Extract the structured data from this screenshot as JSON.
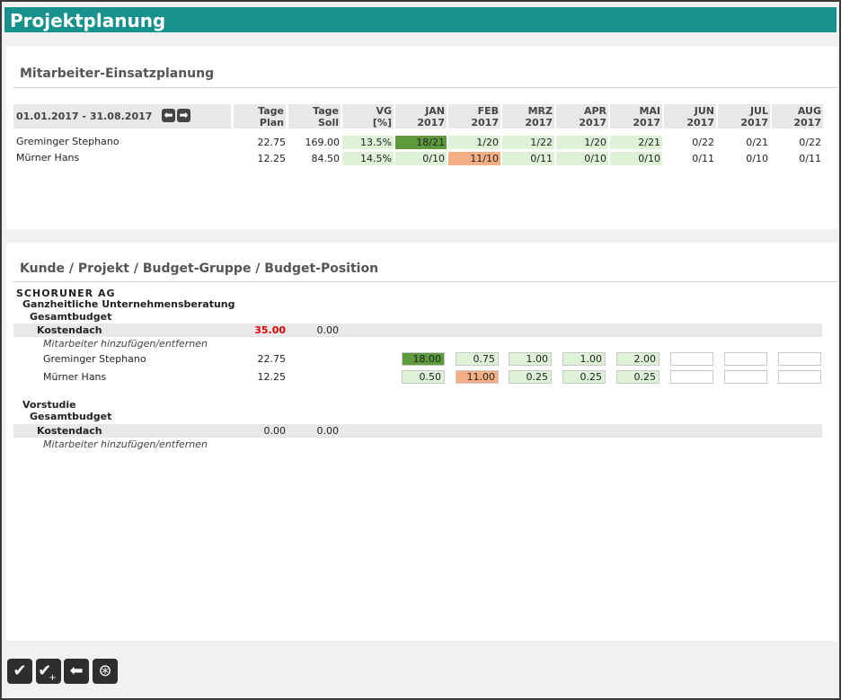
{
  "app": {
    "title": "Projektplanung"
  },
  "section1": {
    "title": "Mitarbeiter-Einsatzplanung",
    "date_range": "01.01.2017 - 31.08.2017",
    "headers": {
      "plan": [
        "Tage",
        "Plan"
      ],
      "soll": [
        "Tage",
        "Soll"
      ],
      "vg": [
        "VG",
        "[%]"
      ],
      "months": [
        [
          "JAN",
          "2017"
        ],
        [
          "FEB",
          "2017"
        ],
        [
          "MRZ",
          "2017"
        ],
        [
          "APR",
          "2017"
        ],
        [
          "MAI",
          "2017"
        ],
        [
          "JUN",
          "2017"
        ],
        [
          "JUL",
          "2017"
        ],
        [
          "AUG",
          "2017"
        ]
      ]
    },
    "rows": [
      {
        "name": "Greminger Stephano",
        "plan": "22.75",
        "soll": "169.00",
        "vg": "13.5%",
        "months": [
          "18/21",
          "1/20",
          "1/22",
          "1/20",
          "2/21",
          "0/22",
          "0/21",
          "0/22"
        ],
        "month_status": [
          "high",
          "light",
          "light",
          "light",
          "light",
          "none",
          "none",
          "none"
        ]
      },
      {
        "name": "Mürner Hans",
        "plan": "12.25",
        "soll": "84.50",
        "vg": "14.5%",
        "months": [
          "0/10",
          "11/10",
          "0/11",
          "0/10",
          "0/10",
          "0/11",
          "0/10",
          "0/11"
        ],
        "month_status": [
          "light",
          "over",
          "light",
          "light",
          "light",
          "none",
          "none",
          "none"
        ]
      }
    ]
  },
  "section2": {
    "title": "Kunde / Projekt / Budget-Gruppe / Budget-Position",
    "client": "SCHORUNER AG",
    "projects": [
      {
        "name": "Ganzheitliche Unternehmensberatung",
        "budget_group": "Gesamtbudget",
        "position": {
          "label": "Kostendach",
          "value1": "35.00",
          "value2": "0.00"
        },
        "add_remove_link": "Mitarbeiter hinzufügen/entfernen",
        "employees": [
          {
            "name": "Greminger Stephano",
            "plan": "22.75",
            "months": [
              "18.00",
              "0.75",
              "1.00",
              "1.00",
              "2.00",
              "",
              "",
              ""
            ]
          },
          {
            "name": "Mürner Hans",
            "plan": "12.25",
            "months": [
              "0.50",
              "11.00",
              "0.25",
              "0.25",
              "0.25",
              "",
              "",
              ""
            ]
          }
        ]
      },
      {
        "name": "Vorstudie",
        "budget_group": "Gesamtbudget",
        "position": {
          "label": "Kostendach",
          "value1": "0.00",
          "value2": "0.00"
        },
        "add_remove_link": "Mitarbeiter hinzufügen/entfernen",
        "employees": []
      }
    ]
  },
  "toolbar": {
    "buttons": [
      {
        "name": "save-button",
        "icon": "check-icon",
        "glyph": "✔"
      },
      {
        "name": "save-add-button",
        "icon": "check-plus-icon",
        "glyph": "✔"
      },
      {
        "name": "back-button",
        "icon": "arrow-left-icon",
        "glyph": "⬅"
      },
      {
        "name": "help-button",
        "icon": "lifebuoy-icon",
        "glyph": "⊛"
      }
    ]
  },
  "colors": {
    "header": "#17918b",
    "over": "#f3ae84",
    "high": "#5e9a3c",
    "light": "#def2d8"
  }
}
